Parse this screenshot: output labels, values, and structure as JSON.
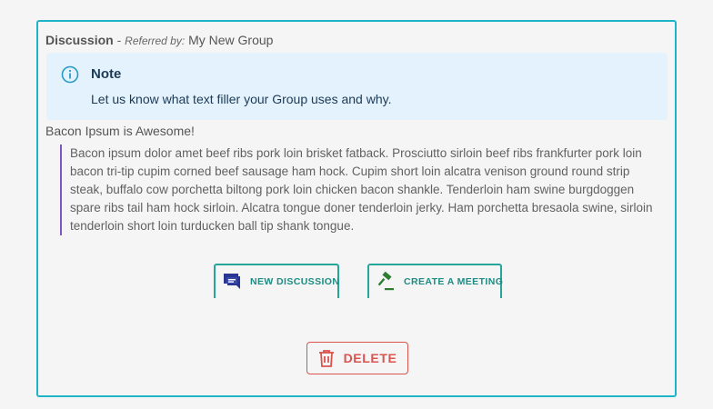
{
  "header": {
    "title": "Discussion",
    "separator": "-",
    "referred_label": "Referred by:",
    "group_name": "My New Group"
  },
  "note": {
    "icon": "info-icon",
    "title": "Note",
    "body": "Let us know what text filler your Group uses and why."
  },
  "post": {
    "subject": "Bacon Ipsum is Awesome!",
    "body": "Bacon ipsum dolor amet beef ribs pork loin brisket fatback. Prosciutto sirloin beef ribs frankfurter pork loin bacon tri-tip cupim corned beef sausage ham hock. Cupim short loin alcatra venison ground round strip steak, buffalo cow porchetta biltong pork loin chicken bacon shankle. Tenderloin ham swine burgdoggen spare ribs tail ham hock sirloin. Alcatra tongue doner tenderloin jerky. Ham porchetta bresaola swine, sirloin tenderloin short loin turducken ball tip shank tongue."
  },
  "actions": {
    "new_discussion": {
      "label": "NEW DISCUSSION",
      "icon": "chat-bubble-icon"
    },
    "create_meeting": {
      "label": "CREATE A MEETING",
      "icon": "gavel-icon"
    },
    "delete": {
      "label": "DELETE",
      "icon": "trash-icon"
    }
  },
  "colors": {
    "card_border": "#1eb4c8",
    "note_background": "#e3f2fc",
    "quote_border": "#7e57c2",
    "action_accent": "#26a69a",
    "delete_red": "#d9534f",
    "discussion_icon": "#283593",
    "meeting_icon": "#2e7d32"
  }
}
